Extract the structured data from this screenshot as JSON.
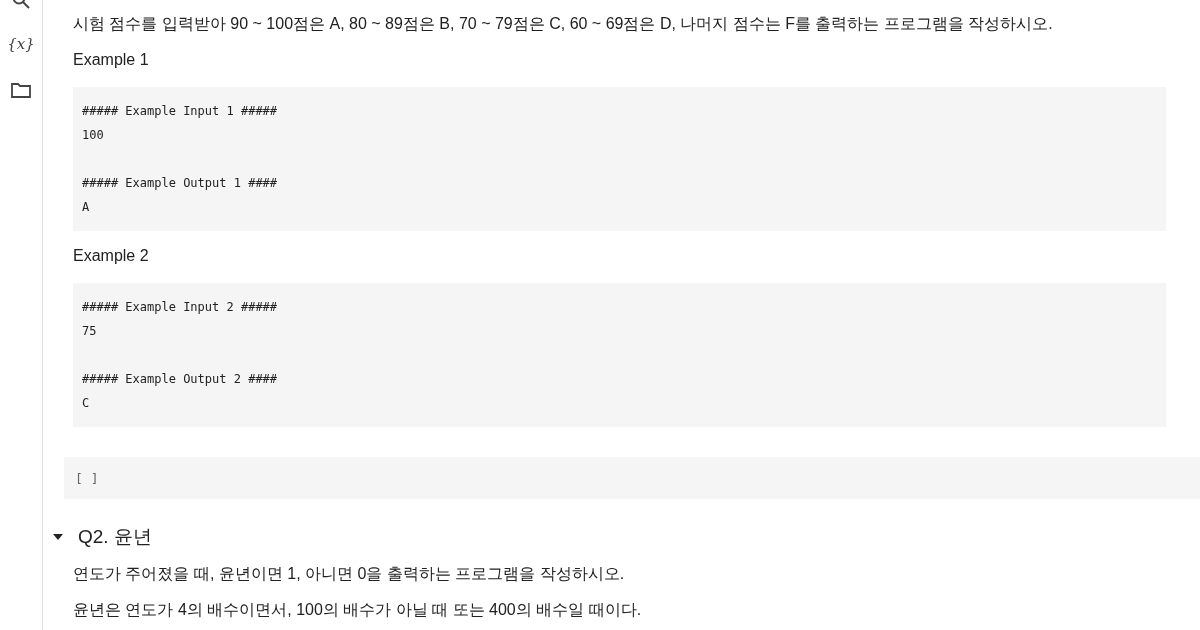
{
  "sidebar": {
    "variables_label": "{x}"
  },
  "intro": "시험 점수를 입력받아 90 ~ 100점은 A, 80 ~ 89점은 B, 70 ~ 79점은 C, 60 ~ 69점은 D, 나머지 점수는 F를 출력하는 프로그램을 작성하시오.",
  "examples": [
    {
      "title": "Example 1",
      "code": "##### Example Input 1 #####\n100\n\n##### Example Output 1 ####\nA"
    },
    {
      "title": "Example 2",
      "code": "##### Example Input 2 #####\n75\n\n##### Example Output 2 ####\nC"
    }
  ],
  "empty_cell": {
    "run_brackets": "[ ]"
  },
  "section": {
    "title": "Q2. 윤년",
    "expanded": true,
    "paragraphs": [
      "연도가 주어졌을 때, 윤년이면 1, 아니면 0을 출력하는 프로그램을 작성하시오.",
      "윤년은 연도가 4의 배수이면서, 100의 배수가 아닐 때 또는 400의 배수일 때이다."
    ]
  }
}
